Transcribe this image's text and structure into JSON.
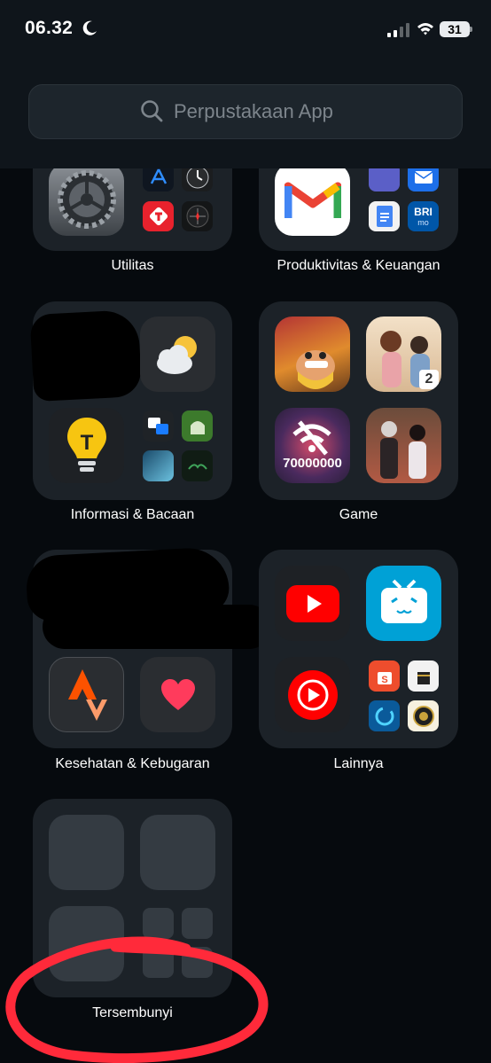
{
  "status_bar": {
    "time": "06.32",
    "battery": "31"
  },
  "search": {
    "placeholder": "Perpustakaan App"
  },
  "folders": [
    {
      "label": "Utilitas"
    },
    {
      "label": "Produktivitas & Keuangan"
    },
    {
      "label": "Informasi & Bacaan"
    },
    {
      "label": "Game"
    },
    {
      "label": "Kesehatan & Kebugaran"
    },
    {
      "label": "Lainnya"
    },
    {
      "label": "Tersembunyi"
    }
  ],
  "icons": {
    "bri_label": "BRI",
    "bri_sub": "mo",
    "game_counter": "70000000",
    "game_badge": "2",
    "tips_letter": "T"
  },
  "colors": {
    "accent_red": "#e8222d",
    "youtube_red": "#ff0000",
    "bilibili_blue": "#00a1d6"
  }
}
